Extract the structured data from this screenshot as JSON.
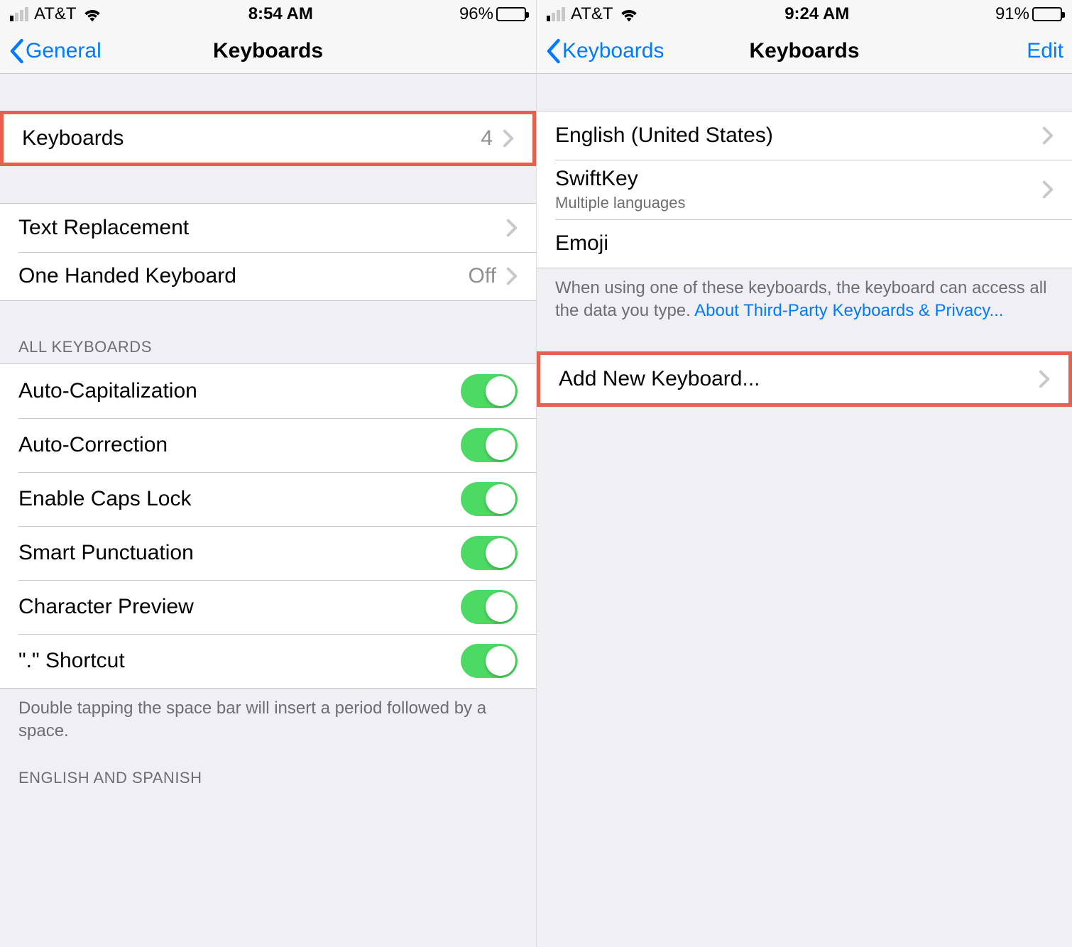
{
  "left": {
    "status": {
      "carrier": "AT&T",
      "time": "8:54 AM",
      "battery_pct": "96%",
      "battery_fill": 96
    },
    "nav": {
      "back_label": "General",
      "title": "Keyboards"
    },
    "group1": {
      "keyboards_label": "Keyboards",
      "keyboards_count": "4"
    },
    "group2": {
      "text_replacement": "Text Replacement",
      "one_handed": "One Handed Keyboard",
      "one_handed_value": "Off"
    },
    "group3_header": "ALL KEYBOARDS",
    "toggles": [
      "Auto-Capitalization",
      "Auto-Correction",
      "Enable Caps Lock",
      "Smart Punctuation",
      "Character Preview",
      "\".\" Shortcut"
    ],
    "group3_footer": "Double tapping the space bar will insert a period followed by a space.",
    "group4_header": "ENGLISH AND SPANISH"
  },
  "right": {
    "status": {
      "carrier": "AT&T",
      "time": "9:24 AM",
      "battery_pct": "91%",
      "battery_fill": 91
    },
    "nav": {
      "back_label": "Keyboards",
      "title": "Keyboards",
      "edit": "Edit"
    },
    "keyboards": {
      "english": "English (United States)",
      "swiftkey": "SwiftKey",
      "swiftkey_sub": "Multiple languages",
      "emoji": "Emoji"
    },
    "footer_text": "When using one of these keyboards, the keyboard can access all the data you type. ",
    "footer_link": "About Third-Party Keyboards & Privacy...",
    "add_new": "Add New Keyboard..."
  }
}
